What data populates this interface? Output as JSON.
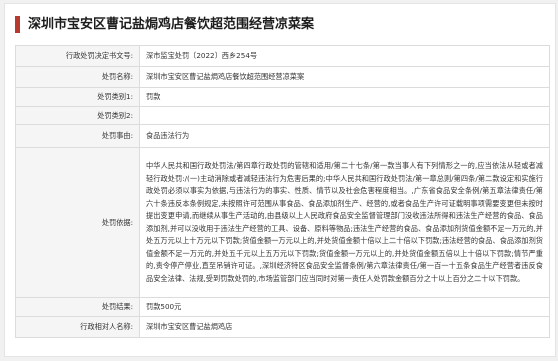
{
  "page": {
    "title": "深圳市宝安区曹记盐焗鸡店餐饮超范围经营凉菜案"
  },
  "table": {
    "rows": [
      {
        "label": "行政处罚决定书文号:",
        "value": "深市监宝处罚〔2022〕西乡254号"
      },
      {
        "label": "处罚名称:",
        "value": "深圳市宝安区曹记盐焗鸡店餐饮超范围经营凉菜案"
      },
      {
        "label": "处罚类别1:",
        "value": "罚款"
      },
      {
        "label": "处罚类别2:",
        "value": ""
      },
      {
        "label": "处罚事由:",
        "value": "食品违法行为"
      },
      {
        "label": "处罚依据:",
        "value": "中华人民共和国行政处罚法/第四章行政处罚的管辖和适用/第二十七条/第一款当事人有下列情形之一的,应当依法从轻或者减轻行政处罚:/(一)主动消除或者减轻违法行为危害后果的;中华人民共和国行政处罚法/第一章总则/第四条/第二款设定和实施行政处罚必须以事实为依据,与违法行为的事实、性质、情节以及社会危害程度相当。,广东省食品安全条例/第五章法律责任/第六十条违反本条例规定,未按照许可范围从事食品、食品添加剂生产、经营的,或者食品生产许可证载明事项需要变更但未按时提出变更申请,而继续从事生产活动的,由县级以上人民政府食品安全监督管理部门没收违法所得和违法生产经营的食品、食品添加剂,并可以没收用于违法生产经营的工具、设备、原料等物品;违法生产经营的食品、食品添加剂货值金额不足一万元的,并处五万元以上十万元以下罚款;货值金额一万元以上的,并处货值金额十倍以上二十倍以下罚款;违法经营的食品、食品添加剂货值金额不足一万元的,并处五千元以上五万元以下罚款;货值金额一万元以上的,并处货值金额五倍以上十倍以下罚款;情节严重的,责令停产停业,直至吊销许可证。,深圳经济特区食品安全监督条例/第六章法律责任/第一百一十五条食品生产经营者违反食品安全法律、法规,受到罚款处罚的,市场监管部门应当同时对第一责任人处罚款金额百分之十以上百分之二十以下罚款。"
      },
      {
        "label": "处罚结果:",
        "value": "罚款500元"
      },
      {
        "label": "行政相对人名称:",
        "value": "深圳市宝安区曹记盐焗鸡店"
      }
    ]
  }
}
